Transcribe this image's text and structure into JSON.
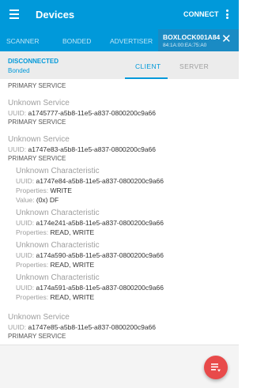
{
  "appbar": {
    "title": "Devices",
    "connect_label": "CONNECT"
  },
  "tabs": [
    {
      "label": "SCANNER"
    },
    {
      "label": "BONDED"
    },
    {
      "label": "ADVERTISER"
    }
  ],
  "device_tab": {
    "name": "BOXLOCK001A84",
    "address": "84:1A:00:EA:75:A0"
  },
  "status": {
    "connection": "DISCONNECTED",
    "bond": "Bonded"
  },
  "subtabs": {
    "client": "CLIENT",
    "server": "SERVER"
  },
  "labels": {
    "uuid": "UUID:",
    "properties": "Properties:",
    "value": "Value:"
  },
  "content": {
    "top_partial_type": "PRIMARY SERVICE",
    "service1": {
      "name": "Unknown Service",
      "uuid": "a1745777-a5b8-11e5-a837-0800200c9a66",
      "type": "PRIMARY SERVICE"
    },
    "service2": {
      "name": "Unknown Service",
      "uuid": "a1747e83-a5b8-11e5-a837-0800200c9a66",
      "type": "PRIMARY SERVICE",
      "characteristics": [
        {
          "name": "Unknown Characteristic",
          "uuid": "a1747e84-a5b8-11e5-a837-0800200c9a66",
          "properties": "WRITE",
          "value": "(0x) DF"
        },
        {
          "name": "Unknown Characteristic",
          "uuid": "a174e241-a5b8-11e5-a837-0800200c9a66",
          "properties": "READ, WRITE"
        },
        {
          "name": "Unknown Characteristic",
          "uuid": "a174a590-a5b8-11e5-a837-0800200c9a66",
          "properties": "READ, WRITE"
        },
        {
          "name": "Unknown Characteristic",
          "uuid": "a174a591-a5b8-11e5-a837-0800200c9a66",
          "properties": "READ, WRITE"
        }
      ]
    },
    "service3": {
      "name": "Unknown Service",
      "uuid": "a1747e85-a5b8-11e5-a837-0800200c9a66",
      "type": "PRIMARY SERVICE"
    }
  },
  "icons": {
    "menu": "hamburger-menu-icon",
    "overflow": "more-vertical-icon",
    "close": "close-icon",
    "fab": "log-list-icon"
  },
  "colors": {
    "primary": "#0099da",
    "fab": "#e84a4a",
    "subheader": "#ececec"
  }
}
